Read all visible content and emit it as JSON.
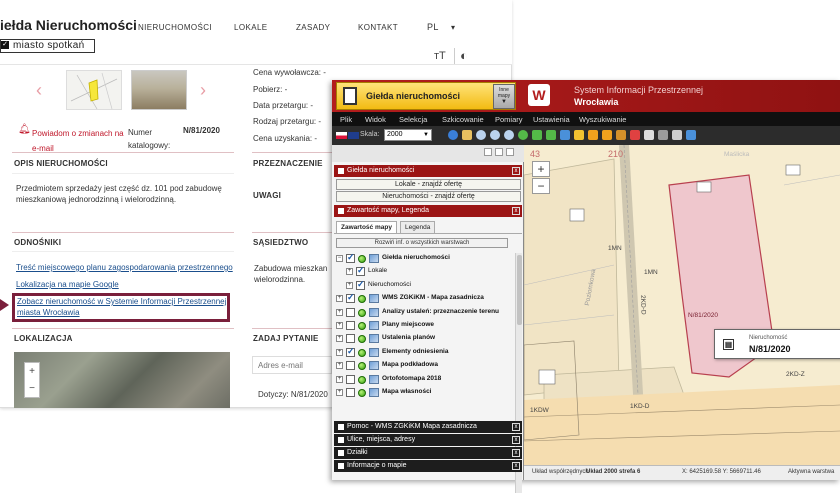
{
  "site": {
    "brand_title": "iełda Nieruchomości",
    "brand_mark": "✓",
    "brand_tagline": "miasto spotkań",
    "nav": [
      "NIERUCHOMOŚCI",
      "LOKALE",
      "ZASADY",
      "KONTAKT"
    ],
    "lang": "PL",
    "lang_caret": "▾",
    "text_size_icon_text": "ᴛT",
    "contrast_icon_text": "◐",
    "prev_arrow": "‹",
    "next_arrow": "›",
    "details": [
      {
        "label": "Cena wywoławcza:",
        "value": "-"
      },
      {
        "label": "Pobierz:",
        "value": "-"
      },
      {
        "label": "Data przetargu:",
        "value": "-"
      },
      {
        "label": "Rodzaj przetargu:",
        "value": "-"
      },
      {
        "label": "Cena uzyskania:",
        "value": "-"
      }
    ],
    "notify_link": "Powiadom o zmianach na e-mail",
    "catalog_label": "Numer katalogowy:",
    "catalog_value": "N/81/2020",
    "sections": {
      "opis": "OPIS NIERUCHOMOŚCI",
      "przeznaczenie": "PRZEZNACZENIE",
      "uwagi": "UWAGI",
      "odnosniki": "ODNOŚNIKI",
      "sasiedztwo": "SĄSIEDZTWO",
      "lokalizacja": "LOKALIZACJA",
      "zadaj_pytanie": "ZADAJ PYTANIE"
    },
    "opis_text": "Przedmiotem sprzedaży jest część dz. 101 pod zabudowę mieszkaniową jednorodzinną i wielorodzinną.",
    "sasiedztwo_text": "Zabudowa mieszkan wielorodzinna.",
    "links": [
      "Treść miejscowego planu zagospodarowania przestrzennego",
      "Lokalizacja na mapie Google",
      "Zobacz nieruchomość w Systemie Informacji Przestrzennej miasta Wrocławia"
    ],
    "email_placeholder": "Adres e-mail",
    "dotyczy": "Dotyczy: N/81/2020",
    "map_zoom_in": "+",
    "map_zoom_out": "−"
  },
  "gis": {
    "gielda_btn": "Giełda nieruchomości",
    "inne_mapy": "Inne mapy",
    "logo_text": "W",
    "title_line1": "System Informacji Przestrzennej",
    "title_line2": "Wrocławia",
    "menu": [
      "Plik",
      "Widok",
      "Selekcja",
      "Szkicowanie",
      "Pomiary",
      "Ustawienia",
      "Wyszukiwanie"
    ],
    "skala_label": "Skala:",
    "skala_value": "2000",
    "panels": {
      "gielda": "Giełda nieruchomości",
      "zawartosc": "Zawartość mapy, Legenda",
      "pomoc": "Pomoc - WMS ZGKiKM Mapa zasadnicza",
      "ulice": "Ulice, miejsca, adresy",
      "dzialki": "Działki",
      "informacje": "Informacje o mapie"
    },
    "panel_close": "x",
    "offer_buttons": [
      "Lokale - znajdź ofertę",
      "Nieruchomości - znajdź ofertę"
    ],
    "tabs": [
      "Zawartość mapy",
      "Legenda"
    ],
    "rozwin": "Rozwiń inf. o wszystkich warstwach",
    "layers": [
      {
        "label": "Giełda nieruchomości",
        "bold": true,
        "plus": "−",
        "checked": true
      },
      {
        "label": "Lokale",
        "bold": false,
        "plus": "+",
        "checked": true
      },
      {
        "label": "Nieruchomości",
        "bold": false,
        "plus": "+",
        "checked": true
      },
      {
        "label": "WMS ZGKiKM - Mapa zasadnicza",
        "bold": true,
        "plus": "+",
        "checked": true
      },
      {
        "label": "Analizy ustaleń: przeznaczenie terenu",
        "bold": true,
        "plus": "+",
        "checked": false
      },
      {
        "label": "Plany miejscowe",
        "bold": true,
        "plus": "+",
        "checked": false
      },
      {
        "label": "Ustalenia planów",
        "bold": true,
        "plus": "+",
        "checked": false
      },
      {
        "label": "Elementy odniesienia",
        "bold": true,
        "plus": "+",
        "checked": true
      },
      {
        "label": "Mapa podkładowa",
        "bold": true,
        "plus": "+",
        "checked": false
      },
      {
        "label": "Ortofotomapa 2018",
        "bold": true,
        "plus": "+",
        "checked": false
      },
      {
        "label": "Mapa własności",
        "bold": true,
        "plus": "+",
        "checked": false
      }
    ],
    "map": {
      "zoom_in": "+",
      "zoom_out": "−",
      "popup_label": "Nieruchomość",
      "popup_value": "N/81/2020",
      "popup_icon": "▦",
      "parcel_label": "N/81/2020",
      "labels": [
        "1MN",
        "1MN",
        "2KD-Z",
        "1KDW",
        "1KD-D",
        "2KD-D",
        "Maślicka",
        "43",
        "210",
        "Poziomkowa"
      ]
    },
    "status": {
      "left": "Układ współrzędnych",
      "system": "Układ 2000 strefa 6",
      "coords": "X: 6425169.58  Y: 5669711.46",
      "right": "Aktywna warstwa"
    }
  }
}
